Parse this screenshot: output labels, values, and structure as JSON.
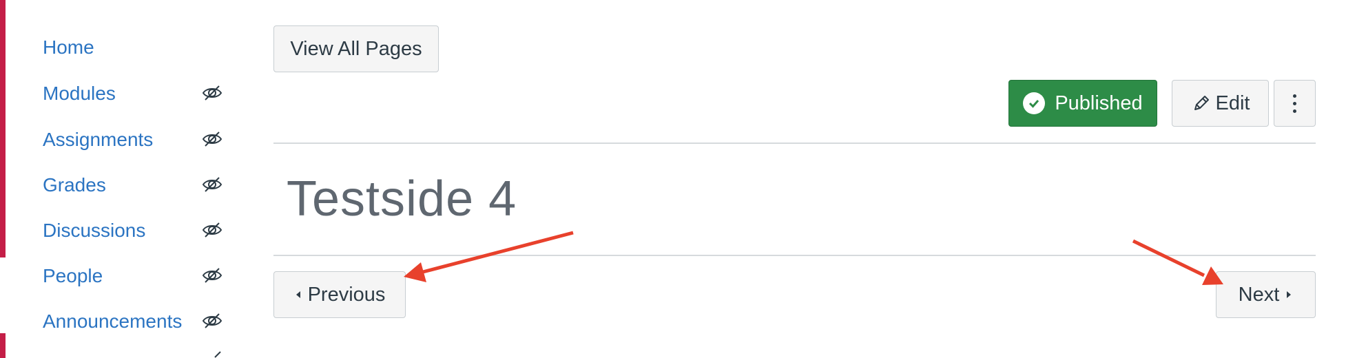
{
  "sidebar": {
    "items": [
      {
        "label": "Home",
        "icon": "none"
      },
      {
        "label": "Modules",
        "icon": "eye-slash-icon"
      },
      {
        "label": "Assignments",
        "icon": "eye-slash-icon"
      },
      {
        "label": "Grades",
        "icon": "eye-slash-icon"
      },
      {
        "label": "Discussions",
        "icon": "eye-slash-icon"
      },
      {
        "label": "People",
        "icon": "eye-slash-icon"
      },
      {
        "label": "Announcements",
        "icon": "eye-slash-icon"
      }
    ]
  },
  "toolbar": {
    "view_all_label": "View All Pages",
    "published_label": "Published",
    "edit_label": "Edit"
  },
  "page": {
    "title": "Testside 4"
  },
  "pagination": {
    "previous_label": "Previous",
    "next_label": "Next"
  },
  "colors": {
    "accent": "#c41e47",
    "link": "#2b74c2",
    "published": "#2d8c47",
    "annotation_arrow": "#e8412c"
  }
}
